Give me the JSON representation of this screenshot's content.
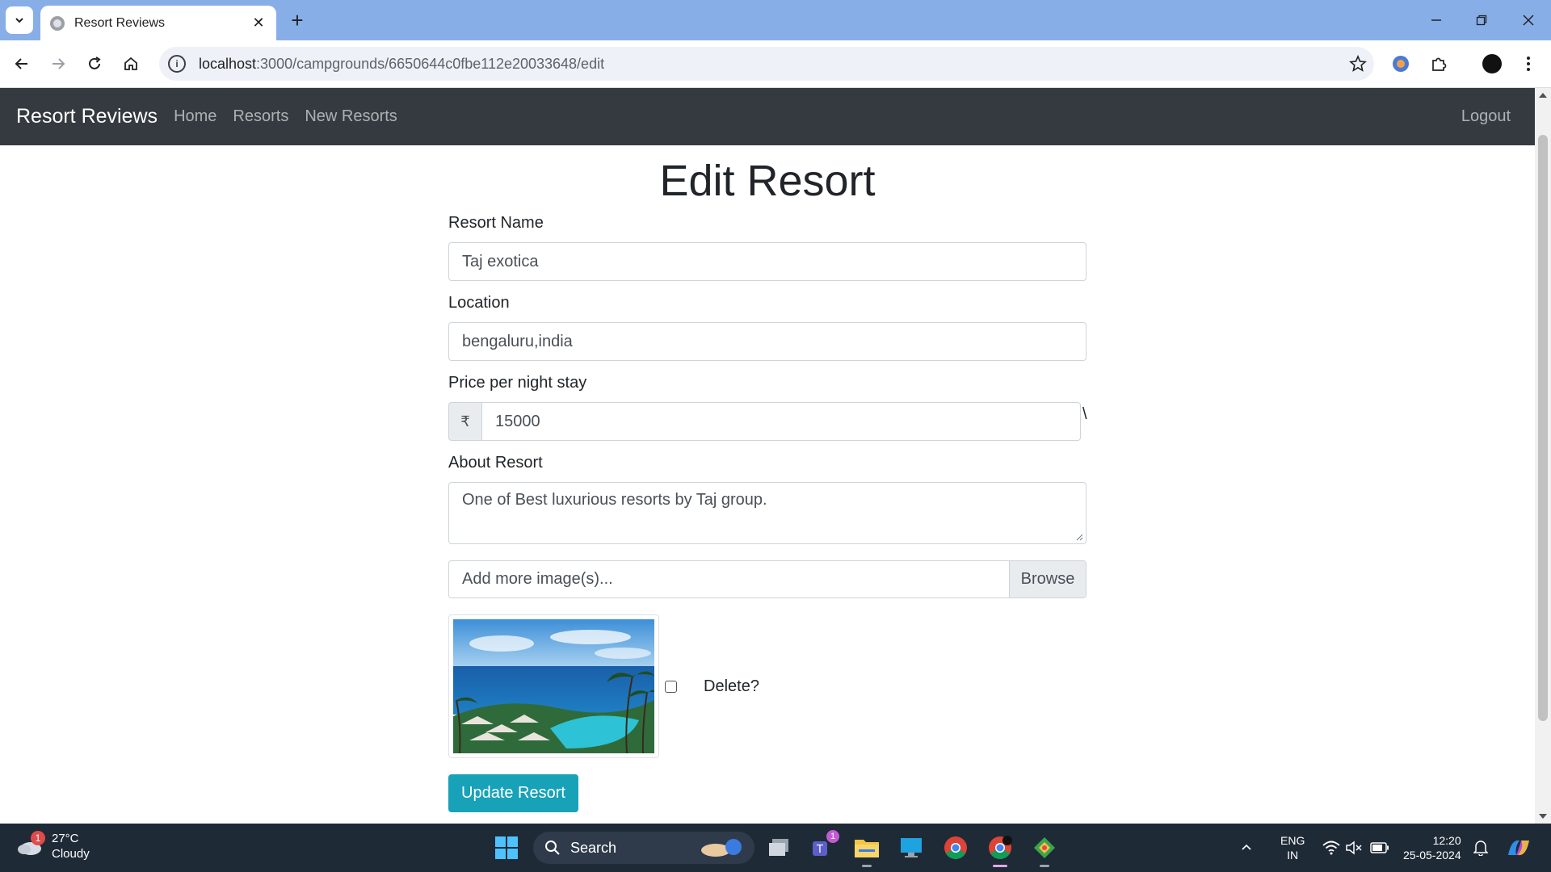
{
  "browser": {
    "tab_title": "Resort Reviews",
    "url_host": "localhost",
    "url_path": ":3000/campgrounds/6650644c0fbe112e20033648/edit"
  },
  "navbar": {
    "brand": "Resort Reviews",
    "links": [
      "Home",
      "Resorts",
      "New Resorts"
    ],
    "logout": "Logout"
  },
  "page": {
    "title": "Edit Resort",
    "name_label": "Resort Name",
    "name_value": "Taj exotica",
    "location_label": "Location",
    "location_value": "bengaluru,india",
    "price_label": "Price per night stay",
    "currency_symbol": "₹",
    "price_value": "15000",
    "stray_char": "\\",
    "about_label": "About Resort",
    "about_value": "One of Best luxurious resorts by Taj group.",
    "file_placeholder": "Add more image(s)...",
    "file_button": "Browse",
    "delete_label": "Delete?",
    "submit_label": "Update Resort"
  },
  "taskbar": {
    "weather_temp": "27°C",
    "weather_desc": "Cloudy",
    "weather_badge": "1",
    "search_label": "Search",
    "teams_badge": "1",
    "lang_line1": "ENG",
    "lang_line2": "IN",
    "time": "12:20",
    "date": "25-05-2024"
  },
  "colors": {
    "navbar_bg": "#343a40",
    "submit_bg": "#17a2b8",
    "tabstrip_bg": "#88aee8",
    "taskbar_bg": "#1f2a37"
  }
}
